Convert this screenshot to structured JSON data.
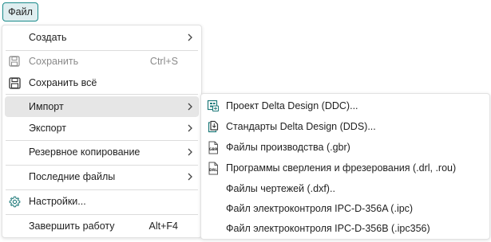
{
  "menubar": {
    "file_label": "Файл"
  },
  "file_menu": {
    "items": [
      {
        "label": "Создать",
        "has_submenu": true
      },
      {
        "label": "Сохранить",
        "shortcut": "Ctrl+S",
        "icon": "save-icon",
        "disabled": true
      },
      {
        "label": "Сохранить всё",
        "icon": "save-all-icon"
      },
      {
        "label": "Импорт",
        "has_submenu": true,
        "active": true
      },
      {
        "label": "Экспорт",
        "has_submenu": true
      },
      {
        "label": "Резервное копирование",
        "has_submenu": true
      },
      {
        "label": "Последние файлы",
        "has_submenu": true
      },
      {
        "label": "Настройки...",
        "icon": "gear-icon"
      },
      {
        "label": "Завершить работу",
        "shortcut": "Alt+F4"
      }
    ]
  },
  "import_submenu": {
    "items": [
      {
        "label": "Проект Delta Design (DDC)...",
        "icon": "ddc-project-icon"
      },
      {
        "label": "Стандарты Delta Design (DDS)...",
        "icon": "dds-standards-icon"
      },
      {
        "label": "Файлы производства (.gbr)",
        "icon": "gbr-file-icon",
        "icon_text": "GBR"
      },
      {
        "label": "Программы сверления и фрезерования (.drl, .rou)",
        "icon": "drl-file-icon",
        "icon_text": "DRL"
      },
      {
        "label": "Файлы чертежей (.dxf).."
      },
      {
        "label": "Файл электроконтроля IPC-D-356A (.ipc)"
      },
      {
        "label": "Файл электроконтроля IPC-D-356B (.ipc356)"
      }
    ]
  },
  "colors": {
    "accent": "#1a8a8a",
    "active_bg": "#e6e6e6",
    "disabled_text": "#8a8a8a",
    "icon_teal": "#1f7a7a"
  }
}
